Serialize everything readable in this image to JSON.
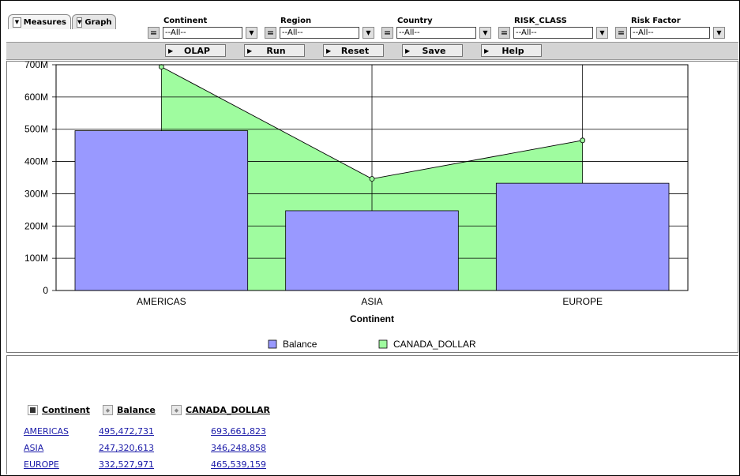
{
  "tabs": [
    {
      "label": "Measures",
      "active": true
    },
    {
      "label": "Graph",
      "active": false
    }
  ],
  "filters": [
    {
      "label": "Continent",
      "value": "--All--"
    },
    {
      "label": "Region",
      "value": "--All--"
    },
    {
      "label": "Country",
      "value": "--All--"
    },
    {
      "label": "RISK_CLASS",
      "value": "--All--"
    },
    {
      "label": "Risk Factor",
      "value": "--All--"
    }
  ],
  "buttons": [
    "OLAP",
    "Run",
    "Reset",
    "Save",
    "Help"
  ],
  "chart_data": {
    "type": "bar",
    "categories": [
      "AMERICAS",
      "ASIA",
      "EUROPE"
    ],
    "series": [
      {
        "name": "Balance",
        "kind": "bar",
        "color": "#9999ff",
        "values": [
          495472731,
          247320613,
          332527971
        ]
      },
      {
        "name": "CANADA_DOLLAR",
        "kind": "area",
        "color": "#9ffc9f",
        "values": [
          693661823,
          346248858,
          465539159
        ]
      }
    ],
    "yticks": [
      "0",
      "100M",
      "200M",
      "300M",
      "400M",
      "500M",
      "600M",
      "700M"
    ],
    "ylim": [
      0,
      700000000
    ],
    "xlabel": "Continent",
    "legend_position": "bottom",
    "grid": true
  },
  "table": {
    "headers": [
      "Continent",
      "Balance",
      "CANADA_DOLLAR"
    ],
    "rows": [
      [
        "AMERICAS",
        "495,472,731",
        "693,661,823"
      ],
      [
        "ASIA",
        "247,320,613",
        "346,248,858"
      ],
      [
        "EUROPE",
        "332,527,971",
        "465,539,159"
      ]
    ]
  }
}
